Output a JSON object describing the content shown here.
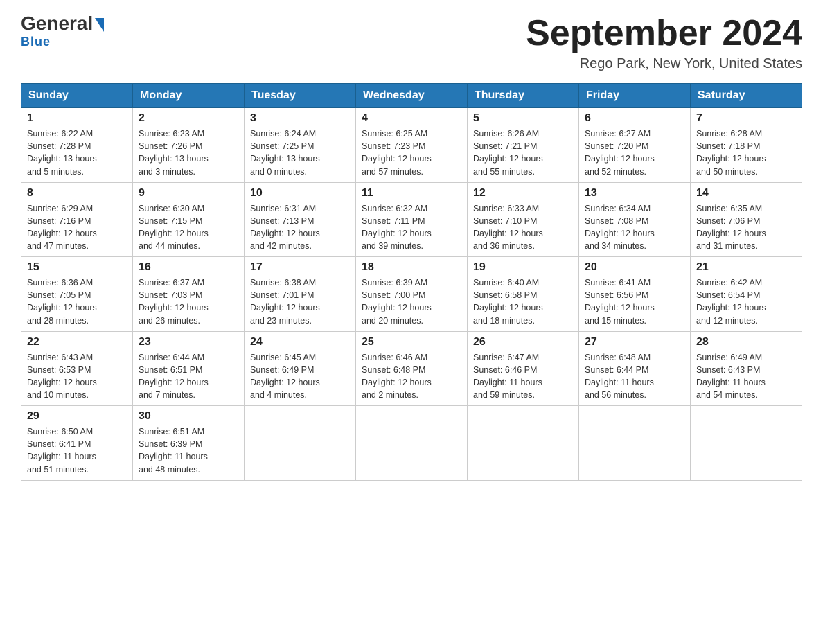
{
  "logo": {
    "main": "General",
    "sub": "Blue"
  },
  "title": "September 2024",
  "location": "Rego Park, New York, United States",
  "days_of_week": [
    "Sunday",
    "Monday",
    "Tuesday",
    "Wednesday",
    "Thursday",
    "Friday",
    "Saturday"
  ],
  "weeks": [
    [
      {
        "day": "1",
        "info": "Sunrise: 6:22 AM\nSunset: 7:28 PM\nDaylight: 13 hours\nand 5 minutes."
      },
      {
        "day": "2",
        "info": "Sunrise: 6:23 AM\nSunset: 7:26 PM\nDaylight: 13 hours\nand 3 minutes."
      },
      {
        "day": "3",
        "info": "Sunrise: 6:24 AM\nSunset: 7:25 PM\nDaylight: 13 hours\nand 0 minutes."
      },
      {
        "day": "4",
        "info": "Sunrise: 6:25 AM\nSunset: 7:23 PM\nDaylight: 12 hours\nand 57 minutes."
      },
      {
        "day": "5",
        "info": "Sunrise: 6:26 AM\nSunset: 7:21 PM\nDaylight: 12 hours\nand 55 minutes."
      },
      {
        "day": "6",
        "info": "Sunrise: 6:27 AM\nSunset: 7:20 PM\nDaylight: 12 hours\nand 52 minutes."
      },
      {
        "day": "7",
        "info": "Sunrise: 6:28 AM\nSunset: 7:18 PM\nDaylight: 12 hours\nand 50 minutes."
      }
    ],
    [
      {
        "day": "8",
        "info": "Sunrise: 6:29 AM\nSunset: 7:16 PM\nDaylight: 12 hours\nand 47 minutes."
      },
      {
        "day": "9",
        "info": "Sunrise: 6:30 AM\nSunset: 7:15 PM\nDaylight: 12 hours\nand 44 minutes."
      },
      {
        "day": "10",
        "info": "Sunrise: 6:31 AM\nSunset: 7:13 PM\nDaylight: 12 hours\nand 42 minutes."
      },
      {
        "day": "11",
        "info": "Sunrise: 6:32 AM\nSunset: 7:11 PM\nDaylight: 12 hours\nand 39 minutes."
      },
      {
        "day": "12",
        "info": "Sunrise: 6:33 AM\nSunset: 7:10 PM\nDaylight: 12 hours\nand 36 minutes."
      },
      {
        "day": "13",
        "info": "Sunrise: 6:34 AM\nSunset: 7:08 PM\nDaylight: 12 hours\nand 34 minutes."
      },
      {
        "day": "14",
        "info": "Sunrise: 6:35 AM\nSunset: 7:06 PM\nDaylight: 12 hours\nand 31 minutes."
      }
    ],
    [
      {
        "day": "15",
        "info": "Sunrise: 6:36 AM\nSunset: 7:05 PM\nDaylight: 12 hours\nand 28 minutes."
      },
      {
        "day": "16",
        "info": "Sunrise: 6:37 AM\nSunset: 7:03 PM\nDaylight: 12 hours\nand 26 minutes."
      },
      {
        "day": "17",
        "info": "Sunrise: 6:38 AM\nSunset: 7:01 PM\nDaylight: 12 hours\nand 23 minutes."
      },
      {
        "day": "18",
        "info": "Sunrise: 6:39 AM\nSunset: 7:00 PM\nDaylight: 12 hours\nand 20 minutes."
      },
      {
        "day": "19",
        "info": "Sunrise: 6:40 AM\nSunset: 6:58 PM\nDaylight: 12 hours\nand 18 minutes."
      },
      {
        "day": "20",
        "info": "Sunrise: 6:41 AM\nSunset: 6:56 PM\nDaylight: 12 hours\nand 15 minutes."
      },
      {
        "day": "21",
        "info": "Sunrise: 6:42 AM\nSunset: 6:54 PM\nDaylight: 12 hours\nand 12 minutes."
      }
    ],
    [
      {
        "day": "22",
        "info": "Sunrise: 6:43 AM\nSunset: 6:53 PM\nDaylight: 12 hours\nand 10 minutes."
      },
      {
        "day": "23",
        "info": "Sunrise: 6:44 AM\nSunset: 6:51 PM\nDaylight: 12 hours\nand 7 minutes."
      },
      {
        "day": "24",
        "info": "Sunrise: 6:45 AM\nSunset: 6:49 PM\nDaylight: 12 hours\nand 4 minutes."
      },
      {
        "day": "25",
        "info": "Sunrise: 6:46 AM\nSunset: 6:48 PM\nDaylight: 12 hours\nand 2 minutes."
      },
      {
        "day": "26",
        "info": "Sunrise: 6:47 AM\nSunset: 6:46 PM\nDaylight: 11 hours\nand 59 minutes."
      },
      {
        "day": "27",
        "info": "Sunrise: 6:48 AM\nSunset: 6:44 PM\nDaylight: 11 hours\nand 56 minutes."
      },
      {
        "day": "28",
        "info": "Sunrise: 6:49 AM\nSunset: 6:43 PM\nDaylight: 11 hours\nand 54 minutes."
      }
    ],
    [
      {
        "day": "29",
        "info": "Sunrise: 6:50 AM\nSunset: 6:41 PM\nDaylight: 11 hours\nand 51 minutes."
      },
      {
        "day": "30",
        "info": "Sunrise: 6:51 AM\nSunset: 6:39 PM\nDaylight: 11 hours\nand 48 minutes."
      },
      {
        "day": "",
        "info": ""
      },
      {
        "day": "",
        "info": ""
      },
      {
        "day": "",
        "info": ""
      },
      {
        "day": "",
        "info": ""
      },
      {
        "day": "",
        "info": ""
      }
    ]
  ]
}
